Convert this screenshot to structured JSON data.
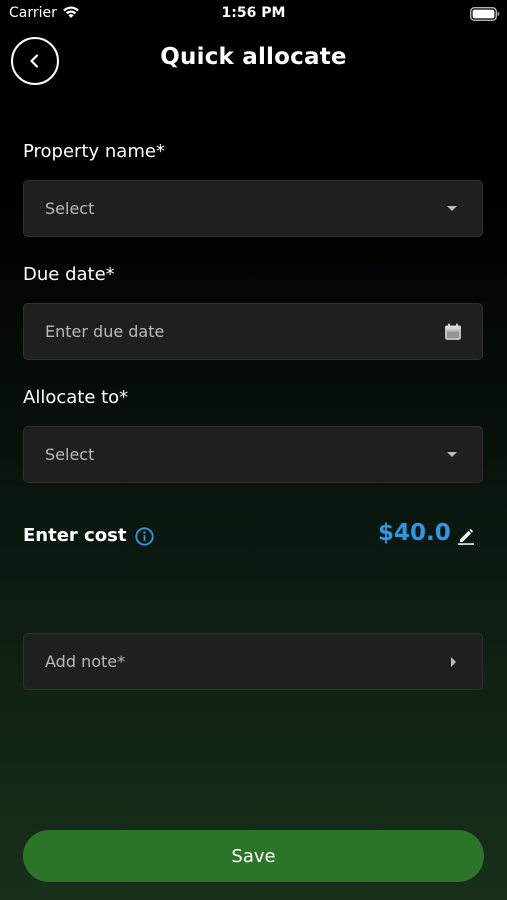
{
  "status_bar": {
    "carrier": "Carrier",
    "time": "1:56 PM"
  },
  "header": {
    "title": "Quick allocate",
    "back_icon": "chevron-left-icon"
  },
  "form": {
    "property": {
      "label": "Property name*",
      "value": "Select"
    },
    "due_date": {
      "label": "Due date*",
      "placeholder": "Enter due date"
    },
    "allocate_to": {
      "label": "Allocate to*",
      "value": "Select"
    },
    "cost": {
      "label": "Enter cost",
      "value": "$40.0"
    },
    "note": {
      "placeholder": "Add note*"
    }
  },
  "save_label": "Save",
  "colors": {
    "accent_blue": "#2e97e6",
    "save_green": "#2c7427",
    "field_bg": "#1e1f1f"
  }
}
